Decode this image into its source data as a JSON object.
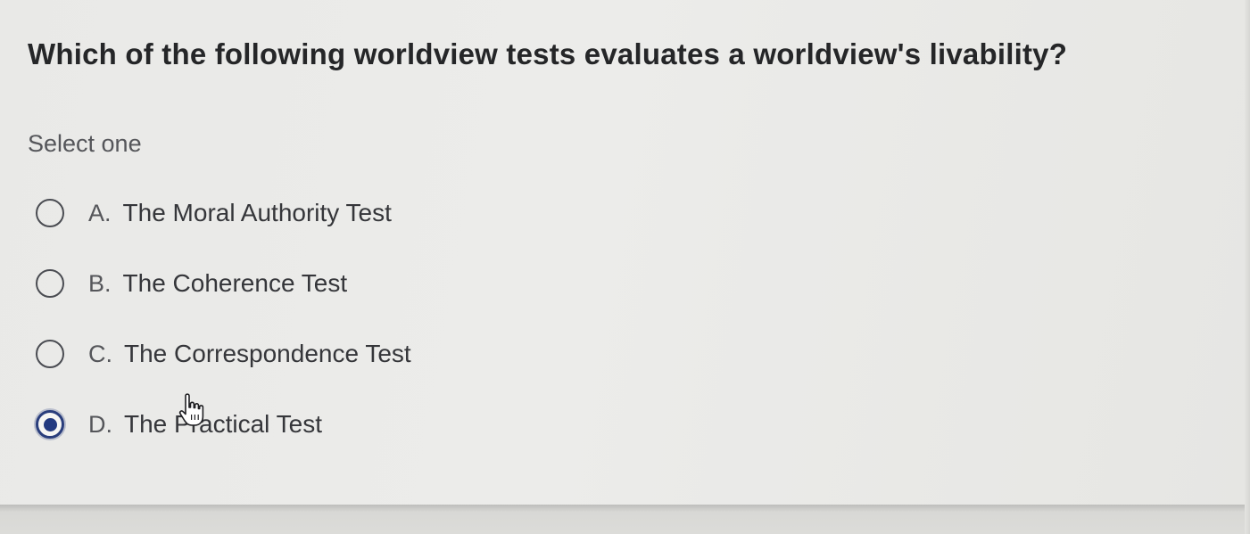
{
  "question": {
    "text": "Which of the following worldview tests evaluates a worldview's livability?"
  },
  "prompt": "Select one",
  "options": [
    {
      "letter": "A.",
      "text": "The Moral Authority Test",
      "selected": false
    },
    {
      "letter": "B.",
      "text": "The Coherence Test",
      "selected": false
    },
    {
      "letter": "C.",
      "text": "The Correspondence Test",
      "selected": false
    },
    {
      "letter": "D.",
      "text": "The Practical Test",
      "selected": true
    }
  ],
  "cursor": {
    "icon": "hand-pointer-icon"
  },
  "colors": {
    "radio_selected": "#233a80",
    "radio_border": "#4a4c52",
    "background": "#ebebe9"
  }
}
